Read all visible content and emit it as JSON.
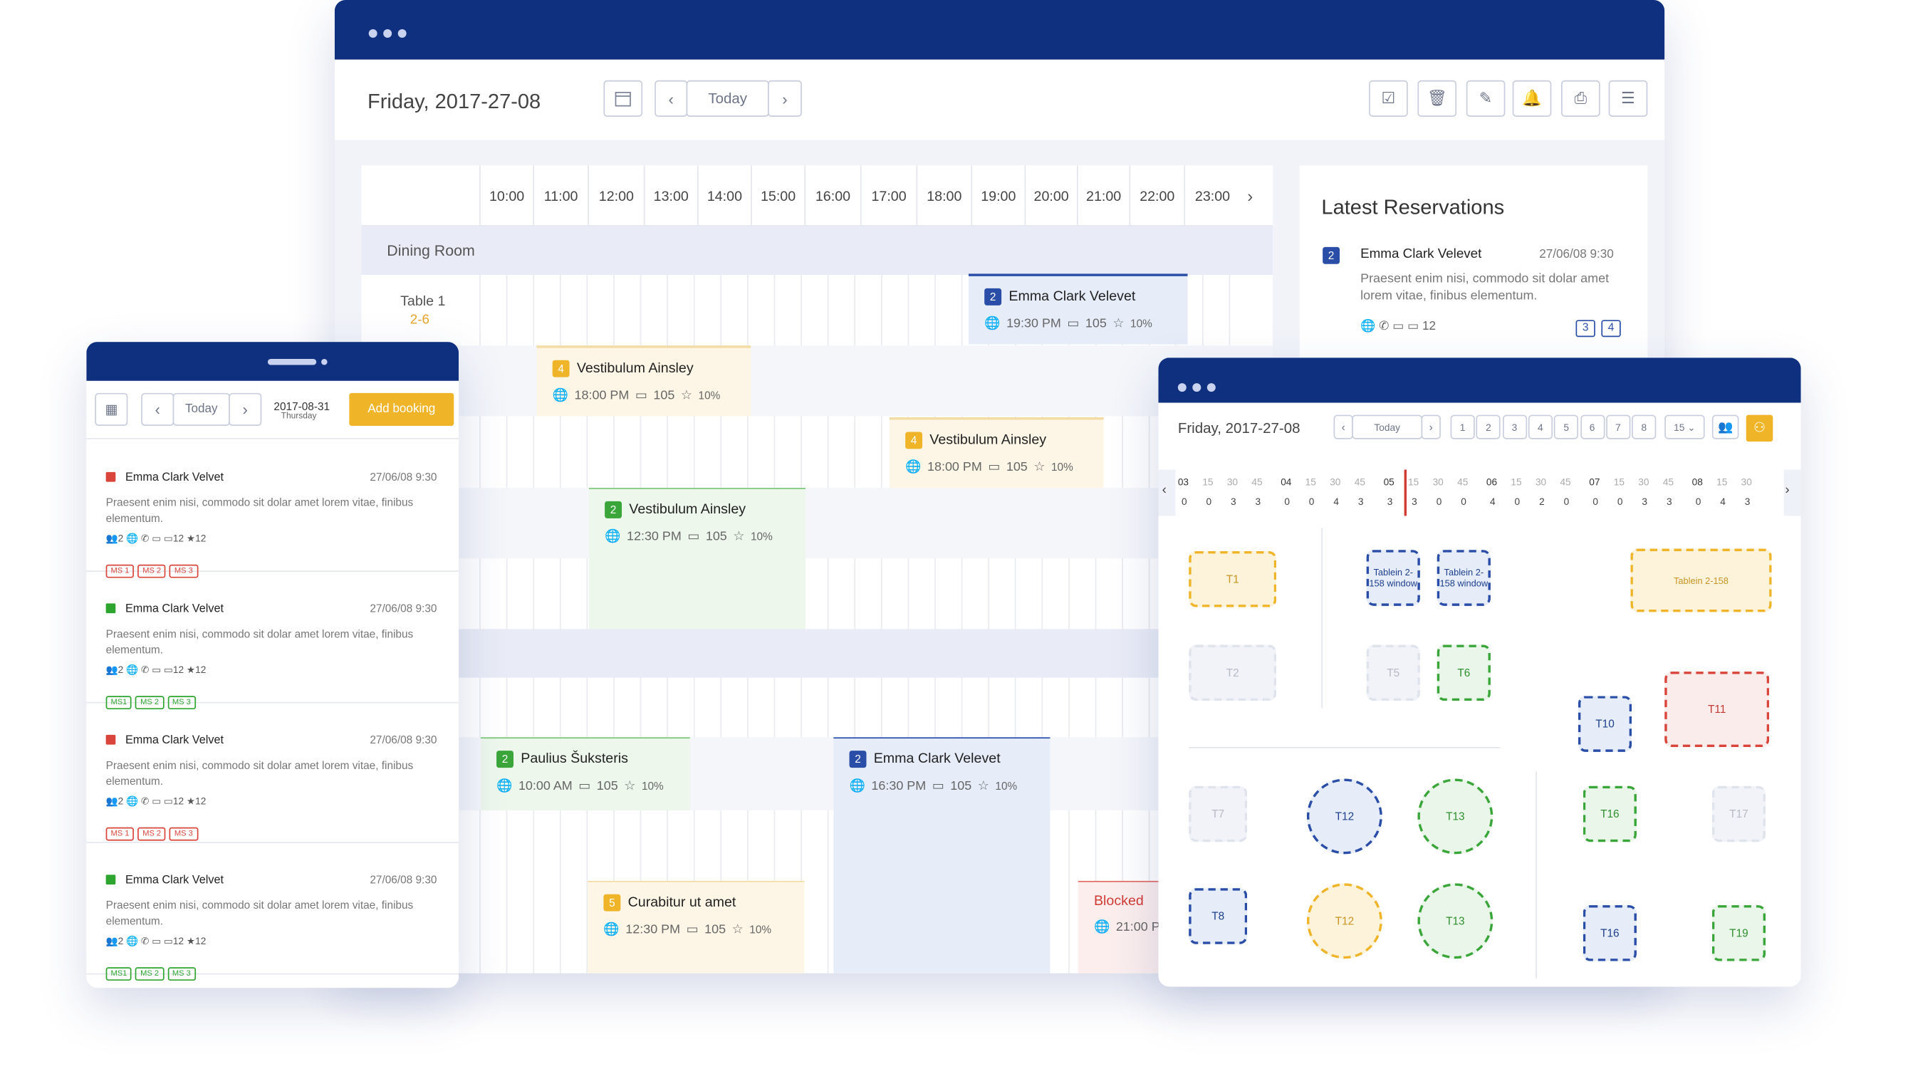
{
  "main_window": {
    "date": "Friday, 2017-27-08",
    "today_label": "Today",
    "hours": [
      "10:00",
      "11:00",
      "12:00",
      "13:00",
      "14:00",
      "15:00",
      "16:00",
      "17:00",
      "18:00",
      "19:00",
      "20:00",
      "21:00",
      "22:00",
      "23:00"
    ],
    "room": "Dining Room",
    "table1_name": "Table 1",
    "table1_capacity": "2-6",
    "reservations": [
      {
        "num": "2",
        "name": "Emma Clark Velevet",
        "time": "19:30 PM",
        "count": "105",
        "pct": "10%",
        "color": "#2a4ea8"
      },
      {
        "num": "4",
        "name": "Vestibulum Ainsley",
        "time": "18:00 PM",
        "count": "105",
        "pct": "10%",
        "color": "#f0b429"
      },
      {
        "num": "4",
        "name": "Vestibulum Ainsley",
        "time": "18:00 PM",
        "count": "105",
        "pct": "10%",
        "color": "#f0b429"
      },
      {
        "num": "2",
        "name": "Vestibulum Ainsley",
        "time": "12:30 PM",
        "count": "105",
        "pct": "10%",
        "color": "#3aa63a"
      },
      {
        "num": "2",
        "name": "Paulius Šuksteris",
        "time": "10:00 AM",
        "count": "105",
        "pct": "10%",
        "color": "#3aa63a"
      },
      {
        "num": "2",
        "name": "Emma Clark Velevet",
        "time": "16:30 PM",
        "count": "105",
        "pct": "10%",
        "color": "#2a4ea8"
      },
      {
        "num": "5",
        "name": "Curabitur ut amet",
        "time": "12:30 PM",
        "count": "105",
        "pct": "10%",
        "color": "#f0b429"
      }
    ],
    "blocked_label": "Blocked",
    "blocked_time": "21:00 P",
    "latest": {
      "title": "Latest Reservations",
      "num": "2",
      "name": "Emma Clark Velevet",
      "date": "27/06/08 9:30",
      "text": "Praesent enim nisi, commodo sit dolar amet lorem vitae, finibus elementum.",
      "count": "12",
      "tag1": "3",
      "tag2": "4"
    }
  },
  "mobile": {
    "today_label": "Today",
    "date": "2017-08-31",
    "weekday": "Thursday",
    "add_label": "Add booking",
    "items": [
      {
        "name": "Emma Clark Velvet",
        "date": "27/06/08 9:30",
        "text": "Praesent enim nisi, commodo sit dolar amet lorem vitae, finibus elementum.",
        "guests": "2",
        "count": "12",
        "stars": "12",
        "tags": [
          "MS 1",
          "MS 2",
          "MS 3"
        ],
        "status": "#d9453b"
      },
      {
        "name": "Emma Clark Velvet",
        "date": "27/06/08 9:30",
        "text": "Praesent enim nisi, commodo sit dolar amet lorem vitae, finibus elementum.",
        "guests": "2",
        "count": "12",
        "stars": "12",
        "tags": [
          "MS1",
          "MS 2",
          "MS 3"
        ],
        "status": "#2ea52e"
      },
      {
        "name": "Emma Clark Velvet",
        "date": "27/06/08 9:30",
        "text": "Praesent enim nisi, commodo sit dolar amet lorem vitae, finibus elementum.",
        "guests": "2",
        "count": "12",
        "stars": "12",
        "tags": [
          "MS 1",
          "MS 2",
          "MS 3"
        ],
        "status": "#d9453b"
      },
      {
        "name": "Emma Clark Velvet",
        "date": "27/06/08 9:30",
        "text": "Praesent enim nisi, commodo sit dolar amet lorem vitae, finibus elementum.",
        "guests": "2",
        "count": "12",
        "stars": "12",
        "tags": [
          "MS1",
          "MS 2",
          "MS 3"
        ],
        "status": "#2ea52e"
      }
    ]
  },
  "floor": {
    "date": "Friday, 2017-27-08",
    "today_label": "Today",
    "pages": [
      "1",
      "2",
      "3",
      "4",
      "5",
      "6",
      "7",
      "8"
    ],
    "per_page": "15",
    "timeline": [
      {
        "h": "03",
        "m": [
          "15",
          "30",
          "45"
        ],
        "v": [
          "0",
          "0",
          "3",
          "3"
        ]
      },
      {
        "h": "04",
        "m": [
          "15",
          "30",
          "45"
        ],
        "v": [
          "0",
          "0",
          "4",
          "3"
        ]
      },
      {
        "h": "05",
        "m": [
          "15",
          "30",
          "45"
        ],
        "v": [
          "3",
          "3",
          "0",
          "0"
        ]
      },
      {
        "h": "06",
        "m": [
          "15",
          "30",
          "45"
        ],
        "v": [
          "4",
          "0",
          "2",
          "0"
        ]
      },
      {
        "h": "07",
        "m": [
          "15",
          "30",
          "45"
        ],
        "v": [
          "0",
          "0",
          "3",
          "3"
        ]
      },
      {
        "h": "08",
        "m": [
          "15",
          "30"
        ],
        "v": [
          "0",
          "4",
          "3"
        ]
      }
    ],
    "tables": [
      {
        "label": "T1",
        "c": "y"
      },
      {
        "label": "Tablein 2-158 window",
        "c": "b"
      },
      {
        "label": "Tablein 2-158 window",
        "c": "b"
      },
      {
        "label": "Tablein 2-158",
        "c": "y"
      },
      {
        "label": "T2",
        "c": "g0"
      },
      {
        "label": "T5",
        "c": "g0"
      },
      {
        "label": "T6",
        "c": "g"
      },
      {
        "label": "T10",
        "c": "b"
      },
      {
        "label": "T11",
        "c": "r"
      },
      {
        "label": "T7",
        "c": "g0"
      },
      {
        "label": "T12",
        "c": "b"
      },
      {
        "label": "T13",
        "c": "g"
      },
      {
        "label": "T16",
        "c": "g"
      },
      {
        "label": "T17",
        "c": "g0"
      },
      {
        "label": "T8",
        "c": "b"
      },
      {
        "label": "T12",
        "c": "y"
      },
      {
        "label": "T13",
        "c": "g"
      },
      {
        "label": "T16",
        "c": "b"
      },
      {
        "label": "T19",
        "c": "g"
      }
    ]
  }
}
